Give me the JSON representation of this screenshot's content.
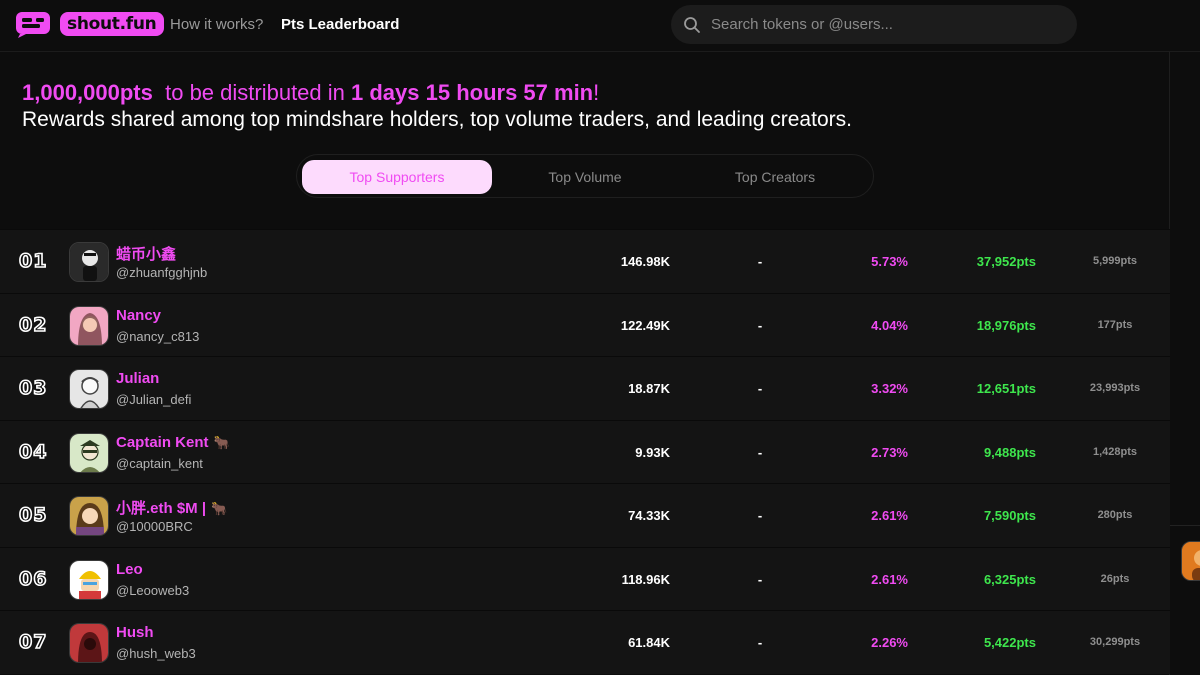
{
  "nav": {
    "logo_text": "shout.fun",
    "links": [
      "How it works?",
      "Pts Leaderboard"
    ],
    "active_link": "Pts Leaderboard",
    "search_placeholder": "Search tokens or @users..."
  },
  "banner": {
    "amount": "1,000,000pts",
    "mid_text": "to be distributed in",
    "countdown": "1 days 15 hours 57 min",
    "exclaim": "!",
    "line2": "Rewards shared among top mindshare holders, top volume traders, and leading creators."
  },
  "tabs": [
    {
      "label": "Top Supporters",
      "active": true
    },
    {
      "label": "Top Volume",
      "active": false
    },
    {
      "label": "Top Creators",
      "active": false
    }
  ],
  "rows": [
    {
      "rank": "01",
      "name": "蜡币小鑫",
      "badge": "",
      "handle": "@zhuanfgghjnb",
      "volume": "146.98K",
      "dash": "-",
      "share": "5.73%",
      "pts": "37,952pts",
      "bonus": "5,999pts"
    },
    {
      "rank": "02",
      "name": "Nancy",
      "badge": "",
      "handle": "@nancy_c813",
      "volume": "122.49K",
      "dash": "-",
      "share": "4.04%",
      "pts": "18,976pts",
      "bonus": "177pts"
    },
    {
      "rank": "03",
      "name": "Julian",
      "badge": "",
      "handle": "@Julian_defi",
      "volume": "18.87K",
      "dash": "-",
      "share": "3.32%",
      "pts": "12,651pts",
      "bonus": "23,993pts"
    },
    {
      "rank": "04",
      "name": "Captain Kent",
      "badge": "🐂",
      "handle": "@captain_kent",
      "volume": "9.93K",
      "dash": "-",
      "share": "2.73%",
      "pts": "9,488pts",
      "bonus": "1,428pts"
    },
    {
      "rank": "05",
      "name": "小胖.eth $M |",
      "badge": "🐂",
      "handle": "@10000BRC",
      "volume": "74.33K",
      "dash": "-",
      "share": "2.61%",
      "pts": "7,590pts",
      "bonus": "280pts"
    },
    {
      "rank": "06",
      "name": "Leo",
      "badge": "",
      "handle": "@Leooweb3",
      "volume": "118.96K",
      "dash": "-",
      "share": "2.61%",
      "pts": "6,325pts",
      "bonus": "26pts"
    },
    {
      "rank": "07",
      "name": "Hush",
      "badge": "",
      "handle": "@hush_web3",
      "volume": "61.84K",
      "dash": "-",
      "share": "2.26%",
      "pts": "5,422pts",
      "bonus": "30,299pts"
    }
  ],
  "avatars": [
    {
      "icon": "cartoon-boy-avatar-icon",
      "bg": "#2a2a2a",
      "fg": "#e8e8e8"
    },
    {
      "icon": "woman-photo-avatar-icon",
      "bg": "#f2a7c3",
      "fg": "#5a2a2a"
    },
    {
      "icon": "sketch-portrait-avatar-icon",
      "bg": "#e6e6e6",
      "fg": "#444444"
    },
    {
      "icon": "captain-portrait-avatar-icon",
      "bg": "#d8e8c8",
      "fg": "#2c3a20"
    },
    {
      "icon": "anime-girl-avatar-icon",
      "bg": "#c9a24a",
      "fg": "#5a3b1a"
    },
    {
      "icon": "yellow-helmet-avatar-icon",
      "bg": "#ffffff",
      "fg": "#f0c000"
    },
    {
      "icon": "hooded-figure-avatar-icon",
      "bg": "#c0393b",
      "fg": "#5c1517"
    }
  ],
  "colors": {
    "accent_pink": "#f04bf2",
    "points_green": "#3ee64d",
    "tab_active_bg": "#fddbfd"
  }
}
